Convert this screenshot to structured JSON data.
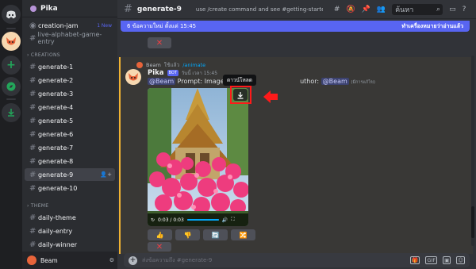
{
  "server": {
    "name": "Pika"
  },
  "channels": {
    "pinned": [
      {
        "label": "creation-jam",
        "badge": "1 New"
      },
      {
        "label": "live-alphabet-game-entry"
      }
    ],
    "creations_category": "CREATIONS",
    "creations": [
      "generate-1",
      "generate-2",
      "generate-3",
      "generate-4",
      "generate-5",
      "generate-6",
      "generate-7",
      "generate-8",
      "generate-9",
      "generate-10"
    ],
    "theme_category": "THEME",
    "theme": [
      "daily-theme",
      "daily-entry",
      "daily-winner"
    ]
  },
  "user_panel": {
    "name": "Beam"
  },
  "header": {
    "channel": "generate-9",
    "topic": "use /create command and see #getting-started for inst...",
    "search_placeholder": "ค้นหา"
  },
  "banner": {
    "left": "6 ข้อความใหม่ ตั้งแต่ 15:45",
    "right": "ทำเครื่องหมายว่าอ่านแล้ว"
  },
  "message": {
    "reply_user": "Beam",
    "reply_text": "ใช้แล้ว",
    "reply_command": "/animate",
    "author": "Pika",
    "bot_tag": "BOT",
    "time": "วันนี้ เวลา 15:45",
    "mention": "@Beam",
    "prompt_prefix": "Prompt:  Image: 1 A",
    "author_suffix": "uthor: ",
    "mention2": "@Beam",
    "note": "(มีการแก้ไข)",
    "video_time": "0:03 / 0:03",
    "video_progress": 1.0
  },
  "tooltip": "ดาวน์โหลด",
  "composer": {
    "placeholder": "ส่งข้อความถึง #generate-9",
    "gif_label": "GIF"
  },
  "colors": {
    "accent": "#5865f2",
    "highlight_border": "#f0b232",
    "annotation_red": "#ff1a1a"
  }
}
